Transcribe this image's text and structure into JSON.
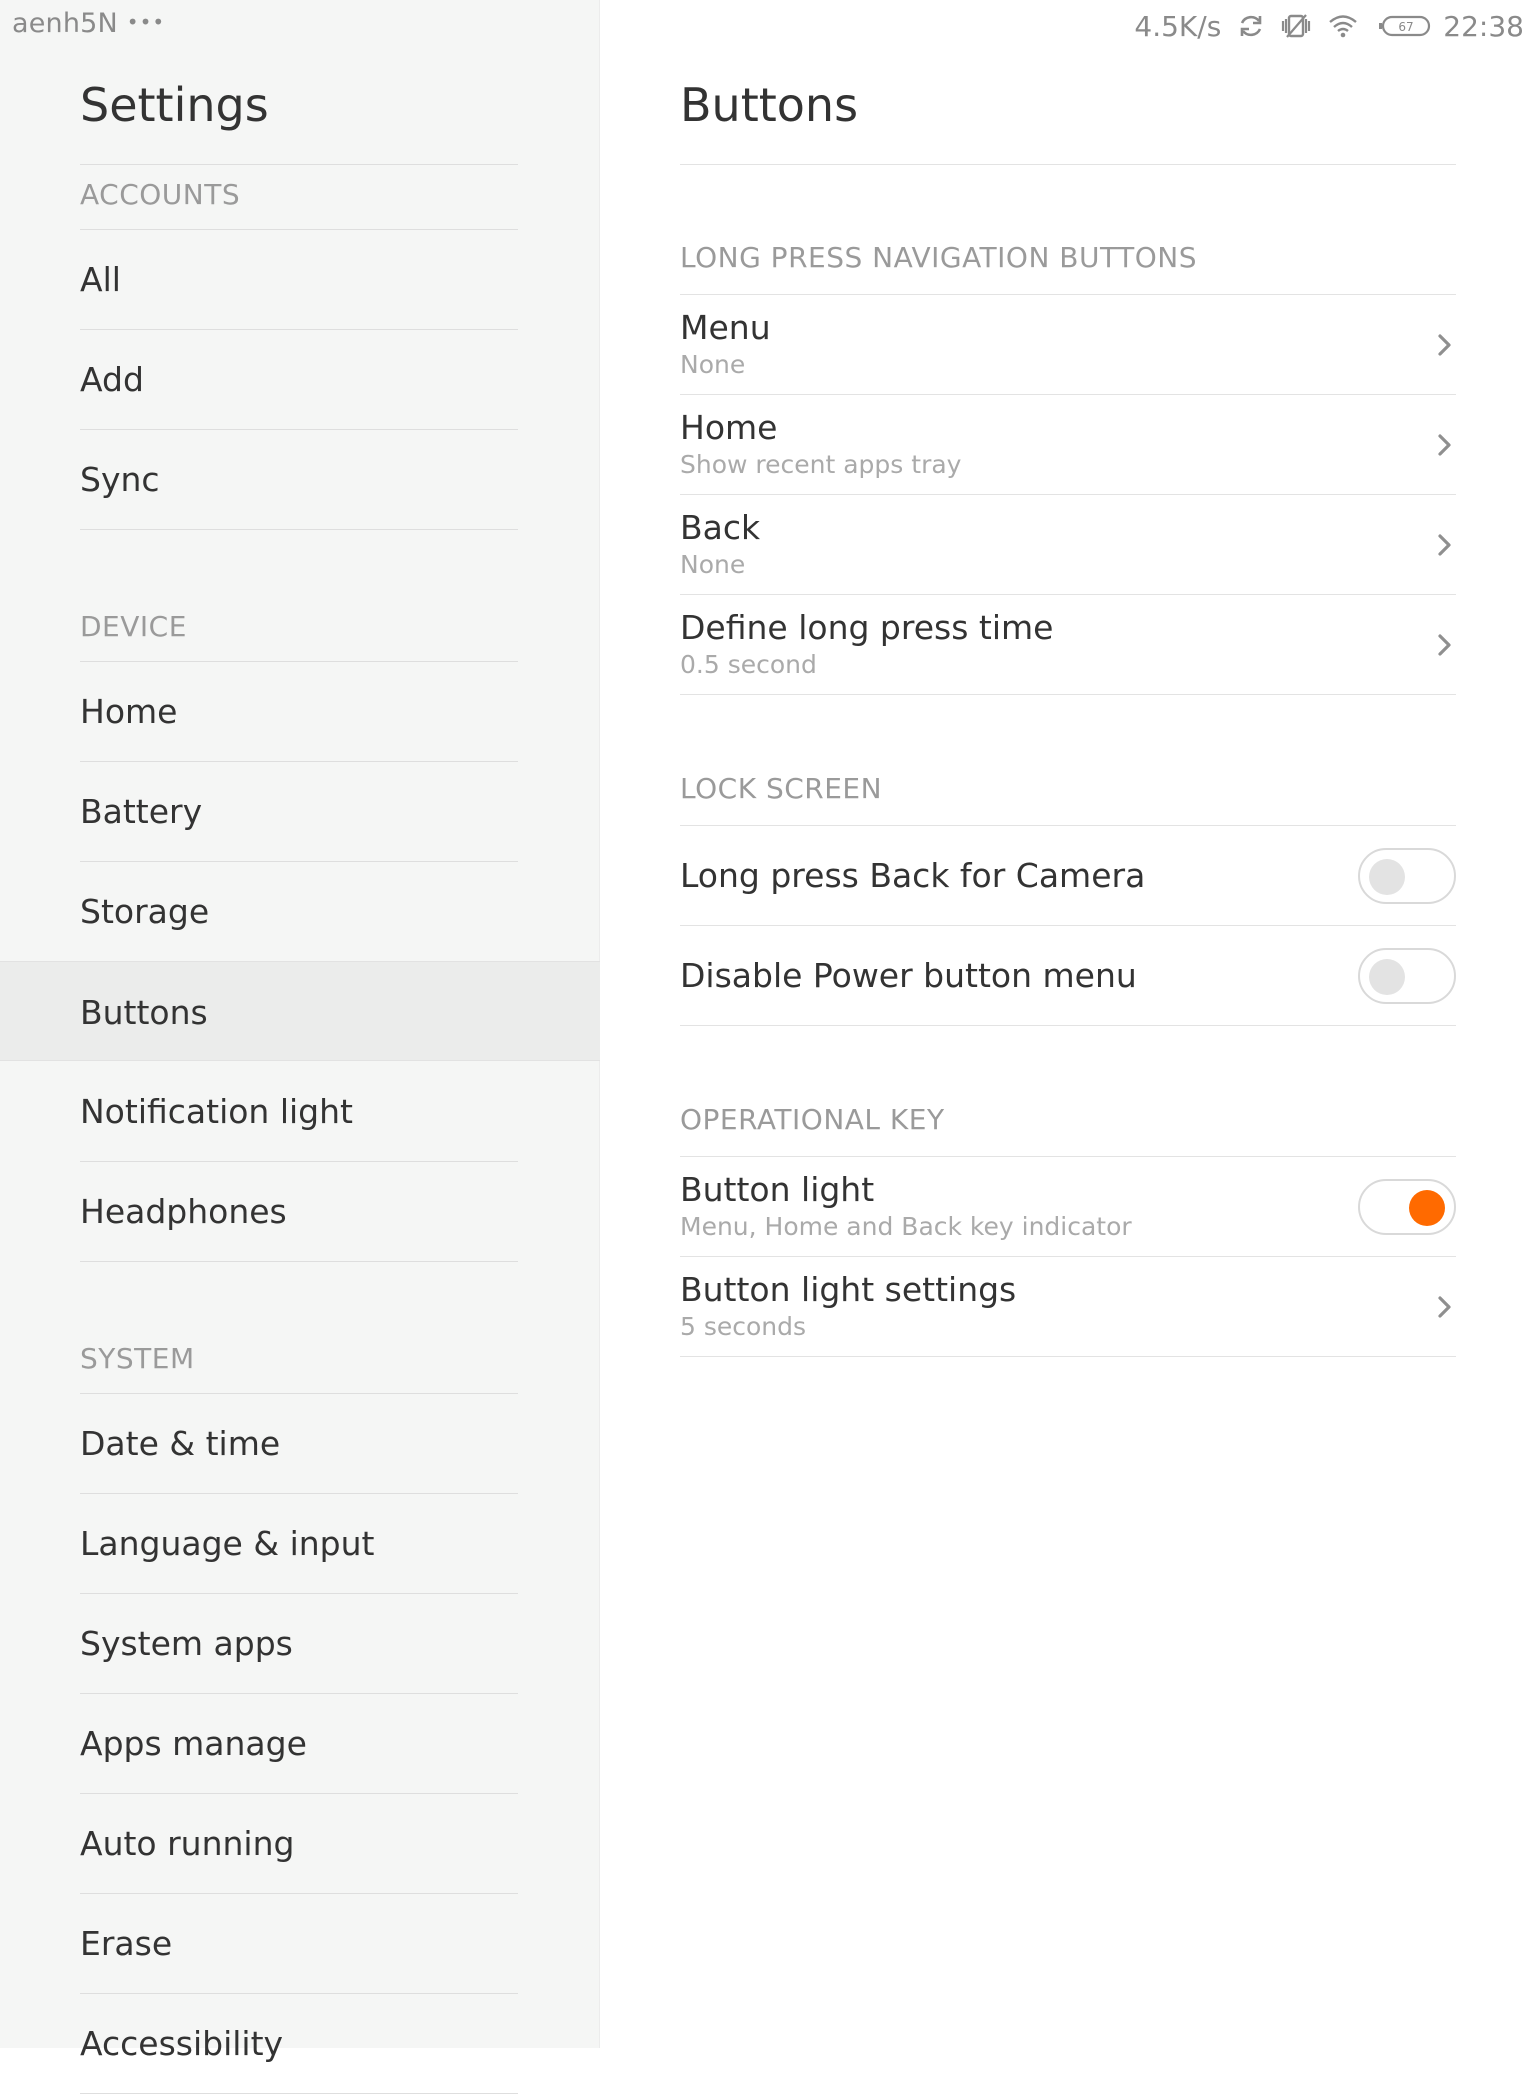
{
  "status_bar": {
    "left_text": "aenh5N",
    "more_dots": "•••",
    "speed": "4.5K/s",
    "battery_level": "67",
    "time": "22:38",
    "icons": [
      "sync-icon",
      "vibrate-icon",
      "wifi-icon",
      "battery-icon"
    ]
  },
  "sidebar": {
    "title": "Settings",
    "sections": [
      {
        "label": "ACCOUNTS",
        "items": [
          {
            "label": "All"
          },
          {
            "label": "Add"
          },
          {
            "label": "Sync"
          }
        ]
      },
      {
        "label": "DEVICE",
        "items": [
          {
            "label": "Home"
          },
          {
            "label": "Battery"
          },
          {
            "label": "Storage"
          },
          {
            "label": "Buttons",
            "selected": true
          },
          {
            "label": "Notification light"
          },
          {
            "label": "Headphones"
          }
        ]
      },
      {
        "label": "SYSTEM",
        "items": [
          {
            "label": "Date & time"
          },
          {
            "label": "Language & input"
          },
          {
            "label": "System apps"
          },
          {
            "label": "Apps manage"
          },
          {
            "label": "Auto running"
          },
          {
            "label": "Erase"
          },
          {
            "label": "Accessibility"
          }
        ]
      }
    ]
  },
  "content": {
    "title": "Buttons",
    "groups": [
      {
        "header": "LONG PRESS NAVIGATION BUTTONS",
        "rows": [
          {
            "title": "Menu",
            "sub": "None",
            "control": "chevron"
          },
          {
            "title": "Home",
            "sub": "Show recent apps tray",
            "control": "chevron"
          },
          {
            "title": "Back",
            "sub": "None",
            "control": "chevron"
          },
          {
            "title": "Define long press time",
            "sub": "0.5 second",
            "control": "chevron"
          }
        ]
      },
      {
        "header": "LOCK SCREEN",
        "rows": [
          {
            "title": "Long press Back for Camera",
            "sub": "",
            "control": "toggle",
            "on": false
          },
          {
            "title": "Disable Power button menu",
            "sub": "",
            "control": "toggle",
            "on": false
          }
        ]
      },
      {
        "header": "OPERATIONAL KEY",
        "rows": [
          {
            "title": "Button light",
            "sub": "Menu, Home and Back key indicator",
            "control": "toggle",
            "on": true
          },
          {
            "title": "Button light settings",
            "sub": "5 seconds",
            "control": "chevron"
          }
        ]
      }
    ]
  },
  "colors": {
    "accent": "#ff6a00",
    "sidebar_bg": "#f5f6f5",
    "selected_bg": "#ebeceb",
    "text_primary": "#333333",
    "text_secondary": "#aaaaaa",
    "section_label": "#9a9a9a"
  }
}
